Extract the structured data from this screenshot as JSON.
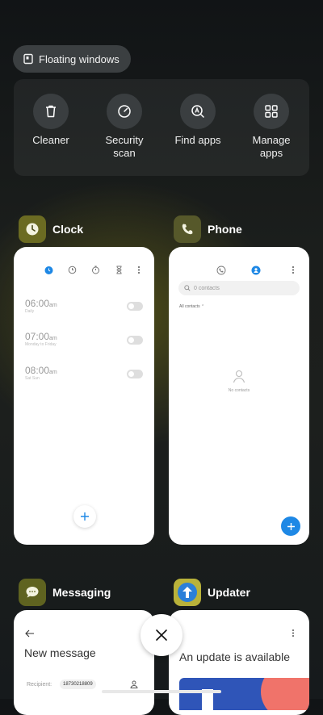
{
  "floating_windows": {
    "label": "Floating windows"
  },
  "tools": [
    {
      "label_line1": "Cleaner",
      "label_line2": "",
      "icon": "trash-icon"
    },
    {
      "label_line1": "Security",
      "label_line2": "scan",
      "icon": "gauge-icon"
    },
    {
      "label_line1": "Find apps",
      "label_line2": "",
      "icon": "find-apps-icon"
    },
    {
      "label_line1": "Manage",
      "label_line2": "apps",
      "icon": "grid-icon"
    }
  ],
  "apps": {
    "clock": {
      "name": "Clock",
      "alarms": [
        {
          "time": "06:00",
          "ampm": "am",
          "repeat": "Daily"
        },
        {
          "time": "07:00",
          "ampm": "am",
          "repeat": "Monday to Friday"
        },
        {
          "time": "08:00",
          "ampm": "am",
          "repeat": "Sat Sun"
        }
      ]
    },
    "phone": {
      "name": "Phone",
      "search_placeholder": "0 contacts",
      "filter_label": "All contacts",
      "empty_label": "No contacts"
    },
    "messaging": {
      "name": "Messaging",
      "title": "New message",
      "recipient_label": "Recipient:",
      "recipient_value": "18730218809"
    },
    "updater": {
      "name": "Updater",
      "title": "An update is available"
    }
  },
  "colors": {
    "accent_blue": "#1e88e5",
    "clock_icon_bg": "#6b6b22",
    "phone_icon_bg": "#56582a",
    "messaging_icon_bg": "#5f6320",
    "updater_icon_bg": "#2a7fd9"
  }
}
